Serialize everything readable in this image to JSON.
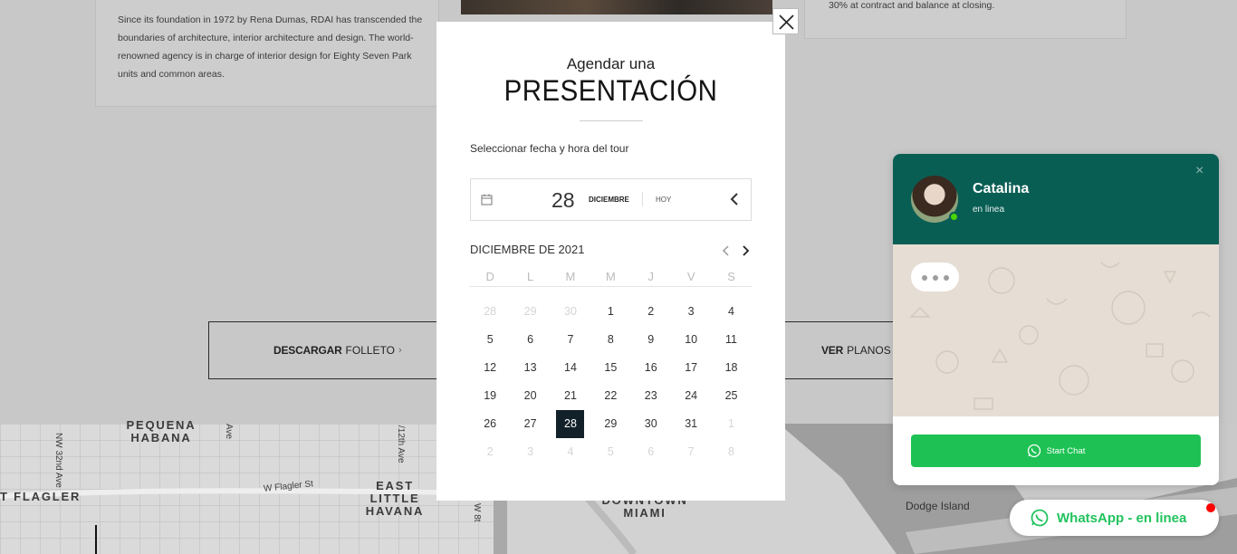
{
  "background": {
    "about_text": "Since its foundation in 1972 by Rena Dumas, RDAI has transcended the boundaries of architecture, interior architecture and design. The world-renowned agency is in charge of interior design for Eighty Seven Park units and common areas.",
    "payment_text": "30% at contract and balance at closing.",
    "buttons": {
      "folleto_bold": "DESCARGAR",
      "folleto_thin": "FOLLETO",
      "folleto_arrow": "›",
      "planos_bold": "VER",
      "planos_thin": "PLANOS D"
    },
    "map": {
      "labels": [
        "PEQUENA HABANA",
        "EAST LITTLE HAVANA",
        "DOWNTOWN MIAMI",
        "T FLAGLER"
      ],
      "streets": [
        "NW 32nd Ave",
        "Ave",
        "/12th Ave",
        "W Flagler St",
        "W 8t"
      ],
      "island": "Dodge Island"
    }
  },
  "modal": {
    "close_glyph": "×",
    "subtitle": "Agendar una",
    "title": "PRESENTACIÓN",
    "instruction": "Seleccionar fecha y hora del tour",
    "date_field": {
      "day": "28",
      "month": "DICIEMBRE",
      "today": "HOY"
    },
    "calendar": {
      "month_label": "DICIEMBRE DE 2021",
      "weekdays": [
        "D",
        "L",
        "M",
        "M",
        "J",
        "V",
        "S"
      ],
      "weeks": [
        [
          {
            "d": "28",
            "m": true
          },
          {
            "d": "29",
            "m": true
          },
          {
            "d": "30",
            "m": true
          },
          {
            "d": "1"
          },
          {
            "d": "2"
          },
          {
            "d": "3"
          },
          {
            "d": "4"
          }
        ],
        [
          {
            "d": "5"
          },
          {
            "d": "6"
          },
          {
            "d": "7"
          },
          {
            "d": "8"
          },
          {
            "d": "9"
          },
          {
            "d": "10"
          },
          {
            "d": "11"
          }
        ],
        [
          {
            "d": "12"
          },
          {
            "d": "13"
          },
          {
            "d": "14"
          },
          {
            "d": "15"
          },
          {
            "d": "16"
          },
          {
            "d": "17"
          },
          {
            "d": "18"
          }
        ],
        [
          {
            "d": "19"
          },
          {
            "d": "20"
          },
          {
            "d": "21"
          },
          {
            "d": "22"
          },
          {
            "d": "23"
          },
          {
            "d": "24"
          },
          {
            "d": "25"
          }
        ],
        [
          {
            "d": "26"
          },
          {
            "d": "27"
          },
          {
            "d": "28",
            "s": true
          },
          {
            "d": "29"
          },
          {
            "d": "30"
          },
          {
            "d": "31"
          },
          {
            "d": "1",
            "m": true
          }
        ],
        [
          {
            "d": "2",
            "m": true
          },
          {
            "d": "3",
            "m": true
          },
          {
            "d": "4",
            "m": true
          },
          {
            "d": "5",
            "m": true
          },
          {
            "d": "6",
            "m": true
          },
          {
            "d": "7",
            "m": true
          },
          {
            "d": "8",
            "m": true
          }
        ]
      ]
    }
  },
  "whatsapp": {
    "name": "Catalina",
    "status": "en linea",
    "close_glyph": "×",
    "start_label": "Start Chat",
    "pill_label": "WhatsApp - en linea",
    "brand_color": "#095e54",
    "button_color": "#1ec254"
  }
}
